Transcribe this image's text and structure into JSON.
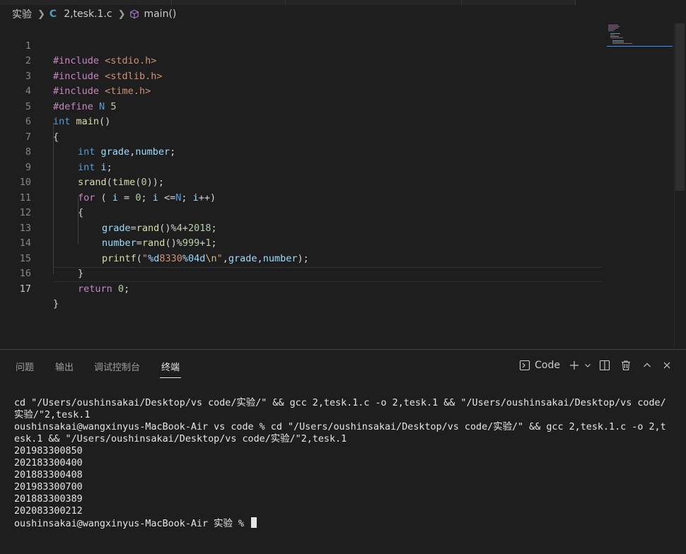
{
  "breadcrumb": {
    "folder": "实验",
    "file_icon": "C",
    "file": "2,tesk.1.c",
    "symbol": "main()"
  },
  "editor": {
    "active_line": "17",
    "line_numbers": [
      "1",
      "2",
      "3",
      "4",
      "5",
      "6",
      "7",
      "8",
      "9",
      "10",
      "11",
      "12",
      "13",
      "14",
      "15",
      "16",
      "17"
    ],
    "tokens": {
      "l1": [
        "#include",
        " ",
        "<stdio.h>"
      ],
      "l2": [
        "#include",
        " ",
        "<stdlib.h>"
      ],
      "l3": [
        "#include",
        " ",
        "<time.h>"
      ],
      "l4": [
        "#define",
        " ",
        "N",
        " ",
        "5"
      ],
      "l5": [
        "int",
        " ",
        "main",
        "()"
      ],
      "l6": [
        "{"
      ],
      "l7": [
        "int",
        " ",
        "grade",
        ",",
        "number",
        ";"
      ],
      "l8": [
        "int",
        " ",
        "i",
        ";"
      ],
      "l9": [
        "srand",
        "(",
        "time",
        "(",
        "0",
        "));"
      ],
      "l10": [
        "for",
        " ( ",
        "i",
        " = ",
        "0",
        "; ",
        "i",
        " <=",
        "N",
        "; ",
        "i",
        "++)"
      ],
      "l11": [
        "{"
      ],
      "l12": [
        "grade",
        "=",
        "rand",
        "()%",
        "4",
        "+",
        "2018",
        ";"
      ],
      "l13": [
        "number",
        "=",
        "rand",
        "()%",
        "999",
        "+",
        "1",
        ";"
      ],
      "l14": [
        "printf",
        "(",
        "\"",
        "%d",
        "8330",
        "%04d",
        "\\n",
        "\"",
        ",",
        "grade",
        ",",
        "number",
        ");"
      ],
      "l15": [
        "}"
      ],
      "l16": [
        "return",
        " ",
        "0",
        ";"
      ],
      "l17": [
        "}"
      ]
    }
  },
  "panel": {
    "tabs": [
      "问题",
      "输出",
      "调试控制台",
      "终端"
    ],
    "active_tab": "终端",
    "terminal_name": "Code",
    "icons": [
      "terminal-icon",
      "plus-icon",
      "chevron-down-icon",
      "split-icon",
      "trash-icon",
      "chevron-up-icon",
      "close-icon"
    ]
  },
  "terminal": {
    "lines": [
      "cd \"/Users/oushinsakai/Desktop/vs code/实验/\" && gcc 2,tesk.1.c -o 2,tesk.1 && \"/Users/oushinsakai/Desktop/vs code/",
      "实验/\"2,tesk.1",
      "oushinsakai@wangxinyus-MacBook-Air vs code % cd \"/Users/oushinsakai/Desktop/vs code/实验/\" && gcc 2,tesk.1.c -o 2,t",
      "esk.1 && \"/Users/oushinsakai/Desktop/vs code/实验/\"2,tesk.1",
      "201983300850",
      "202183300400",
      "201883300408",
      "201983300700",
      "201883300389",
      "202083300212"
    ],
    "prompt": "oushinsakai@wangxinyus-MacBook-Air 实验 % "
  },
  "colors": {
    "background": "#1e1e1e",
    "keyword": "#569cd6",
    "control": "#c586c0",
    "function": "#dcdcaa",
    "variable": "#9cdcfe",
    "number": "#b5cea8",
    "string": "#ce9178"
  }
}
